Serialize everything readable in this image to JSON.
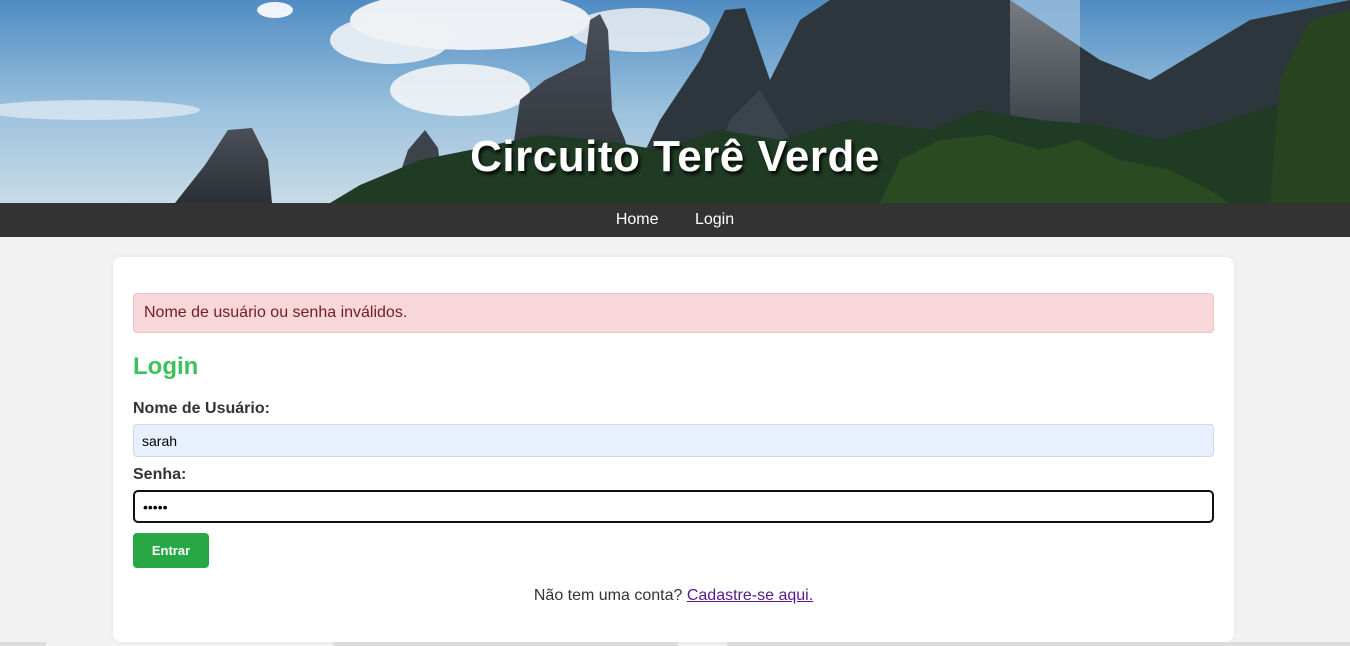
{
  "header": {
    "title": "Circuito Terê Verde"
  },
  "nav": {
    "items": [
      {
        "label": "Home"
      },
      {
        "label": "Login"
      }
    ]
  },
  "alert": {
    "message": "Nome de usuário ou senha inválidos."
  },
  "form": {
    "title": "Login",
    "username_label": "Nome de Usuário:",
    "username_value": "sarah",
    "password_label": "Senha:",
    "password_value": "•••••",
    "submit_label": "Entrar"
  },
  "signup": {
    "prompt": "Não tem uma conta?",
    "link_label": "Cadastre-se aqui."
  },
  "colors": {
    "navbar": "#333333",
    "title_green": "#3cc25a",
    "button_green": "#28a745",
    "alert_bg": "#f8d7da",
    "alert_text": "#721c24",
    "link_visited": "#551a8b"
  }
}
